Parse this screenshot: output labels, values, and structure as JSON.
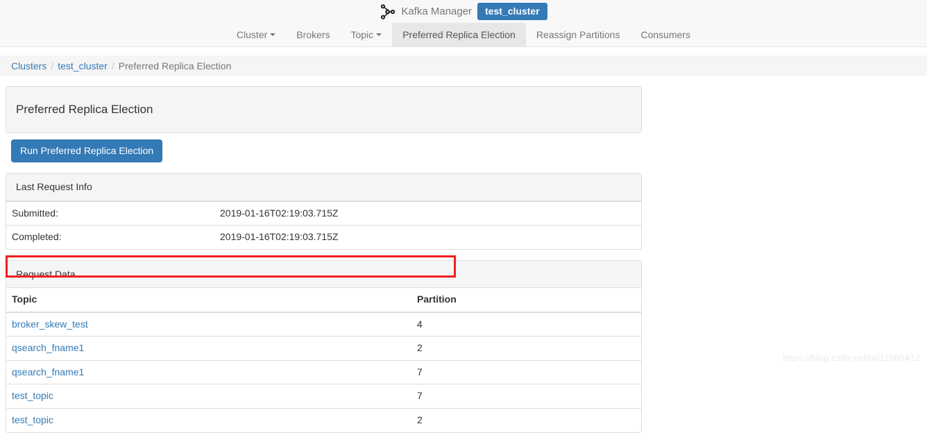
{
  "header": {
    "brand_name": "Kafka Manager",
    "brand_logo_icon": "kafka-logo-icon",
    "cluster_badge": "test_cluster",
    "nav": [
      {
        "label": "Cluster",
        "has_caret": true,
        "active": false
      },
      {
        "label": "Brokers",
        "has_caret": false,
        "active": false
      },
      {
        "label": "Topic",
        "has_caret": true,
        "active": false
      },
      {
        "label": "Preferred Replica Election",
        "has_caret": false,
        "active": true
      },
      {
        "label": "Reassign Partitions",
        "has_caret": false,
        "active": false
      },
      {
        "label": "Consumers",
        "has_caret": false,
        "active": false
      }
    ]
  },
  "breadcrumb": {
    "items": [
      {
        "label": "Clusters",
        "link": true
      },
      {
        "label": "test_cluster",
        "link": true
      },
      {
        "label": "Preferred Replica Election",
        "link": false
      }
    ],
    "separator": "/"
  },
  "main": {
    "page_panel_title": "Preferred Replica Election",
    "run_button_label": "Run Preferred Replica Election",
    "last_request_info": {
      "title": "Last Request Info",
      "rows": [
        {
          "label": "Submitted:",
          "value": "2019-01-16T02:19:03.715Z"
        },
        {
          "label": "Completed:",
          "value": "2019-01-16T02:19:03.715Z"
        }
      ]
    },
    "request_data": {
      "title": "Request Data",
      "columns": [
        "Topic",
        "Partition"
      ],
      "rows": [
        {
          "topic": "broker_skew_test",
          "partition": "4"
        },
        {
          "topic": "qsearch_fname1",
          "partition": "2"
        },
        {
          "topic": "qsearch_fname1",
          "partition": "7"
        },
        {
          "topic": "test_topic",
          "partition": "7"
        },
        {
          "topic": "test_topic",
          "partition": "2"
        }
      ]
    }
  },
  "annotation": {
    "highlight_color": "#f01f1f",
    "highlighted_row_topic": "broker_skew_test",
    "highlighted_row_partition": "4"
  },
  "watermark": {
    "text": "https://blog.csdn.net/u011089412"
  },
  "colors": {
    "primary": "#337ab7",
    "link": "#337ab7",
    "panel_border": "#dddddd",
    "panel_head_bg": "#f5f5f5",
    "nav_bg": "#f8f8f8",
    "nav_active_bg": "#e7e7e7"
  }
}
